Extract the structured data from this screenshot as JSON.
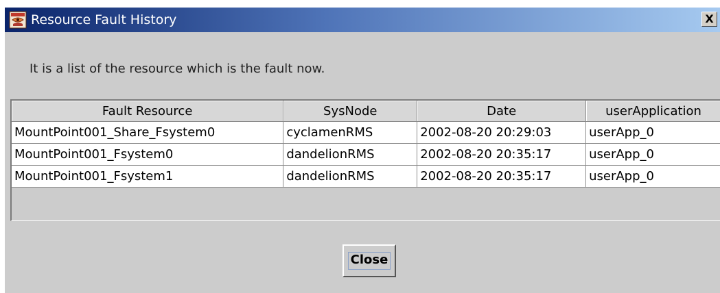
{
  "window": {
    "title": "Resource Fault History",
    "close_glyph": "X",
    "app_icon": "java-app-icon"
  },
  "message": "It is a list of the resource which is the fault now.",
  "table": {
    "columns": [
      "Fault Resource",
      "SysNode",
      "Date",
      "userApplication"
    ],
    "rows": [
      [
        "MountPoint001_Share_Fsystem0",
        "cyclamenRMS",
        "2002-08-20 20:29:03",
        "userApp_0"
      ],
      [
        "MountPoint001_Fsystem0",
        "dandelionRMS",
        "2002-08-20 20:35:17",
        "userApp_0"
      ],
      [
        "MountPoint001_Fsystem1",
        "dandelionRMS",
        "2002-08-20 20:35:17",
        "userApp_0"
      ]
    ]
  },
  "buttons": {
    "close_label": "Close"
  },
  "colors": {
    "titlebar_start": "#0a246a",
    "titlebar_end": "#a6caf0",
    "dialog_background": "#cccccc",
    "table_cell_background": "#ffffff"
  }
}
